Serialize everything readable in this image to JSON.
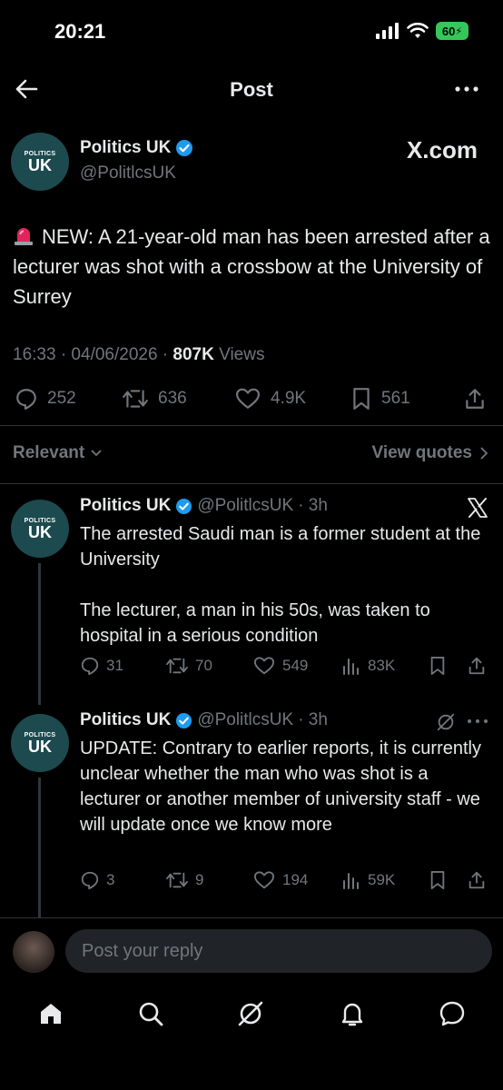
{
  "status": {
    "time": "20:21",
    "battery": "60"
  },
  "nav": {
    "title": "Post"
  },
  "post": {
    "avatar_small": "POLITICS",
    "avatar_big": "UK",
    "name": "Politics UK",
    "handle": "@PolitlcsUK",
    "source": "X.com",
    "text": "NEW: A 21-year-old man has been arrested after a lecturer was shot with a crossbow at the University of Surrey",
    "meta_time": "16:33 · 04/06/2026 · ",
    "views_count": "807K",
    "views_label": " Views",
    "stats": {
      "replies": "252",
      "reposts": "636",
      "likes": "4.9K",
      "bookmarks": "561"
    }
  },
  "filters": {
    "relevant": "Relevant",
    "view_quotes": "View quotes"
  },
  "replies": [
    {
      "name": "Politics UK",
      "handle": "@PolitlcsUK",
      "time": "· 3h",
      "text": "The arrested Saudi man is a former student at the University\n\nThe lecturer, a man in his 50s, was taken to hospital in a serious condition",
      "stats": {
        "replies": "31",
        "reposts": "70",
        "likes": "549",
        "views": "83K"
      }
    },
    {
      "name": "Politics UK",
      "handle": "@PolitlcsUK",
      "time": "· 3h",
      "text": "UPDATE: Contrary to earlier reports, it is currently unclear whether the man who was shot is a lecturer or another member of university staff - we will update once we know more",
      "stats": {
        "replies": "3",
        "reposts": "9",
        "likes": "194",
        "views": "59K"
      }
    }
  ],
  "composer": {
    "placeholder": "Post your reply"
  },
  "icons": {
    "back": "back-arrow-icon",
    "more": "more-icon",
    "verified": "verified-badge-icon",
    "reply": "reply-icon",
    "repost": "repost-icon",
    "like": "heart-icon",
    "bookmark": "bookmark-icon",
    "share": "share-icon",
    "views": "views-icon",
    "home": "home-icon",
    "search": "search-icon",
    "grok": "grok-icon",
    "notifications": "bell-icon",
    "messages": "messages-icon"
  },
  "colors": {
    "background": "#000000",
    "verified": "#1d9bf0",
    "muted": "#71767b",
    "avatar": "#1c4a4f"
  }
}
